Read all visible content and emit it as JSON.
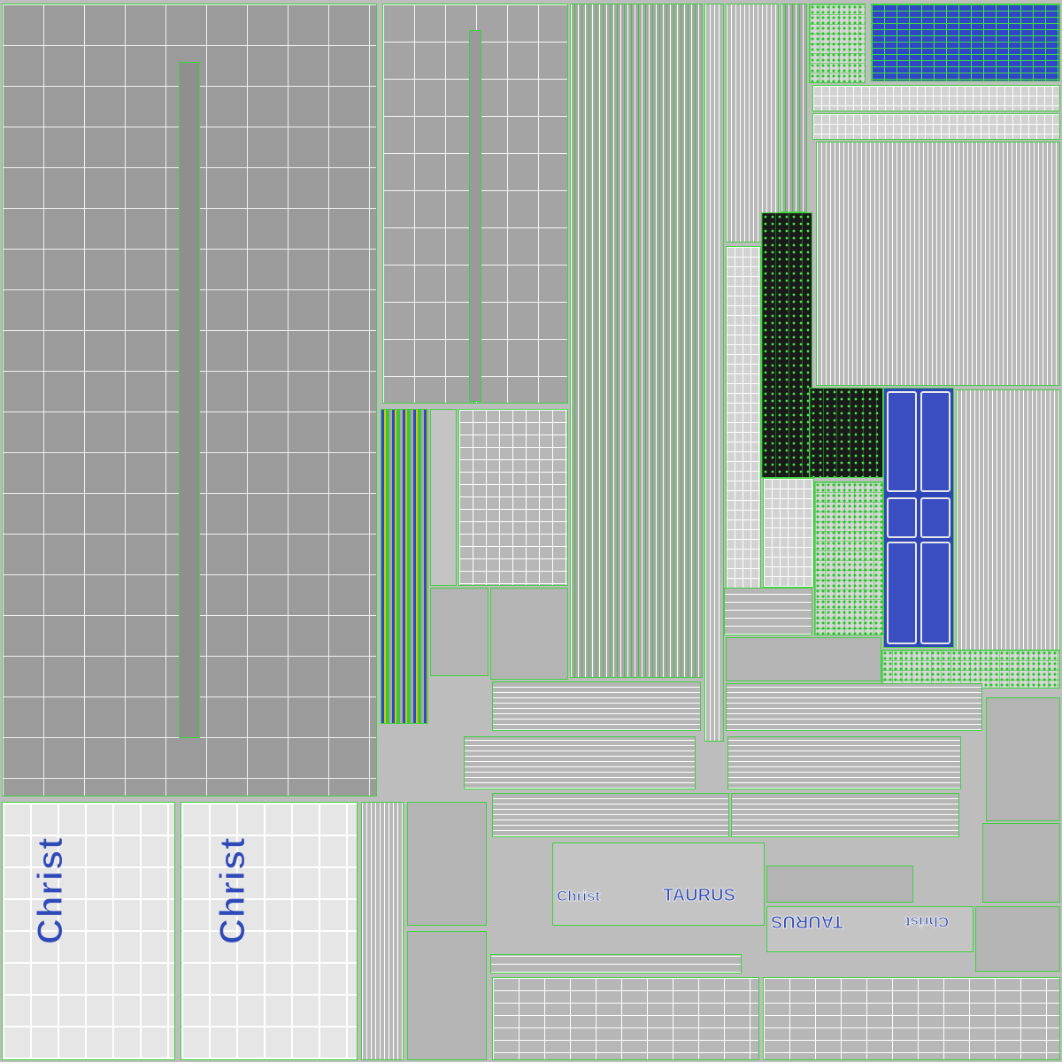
{
  "texture": {
    "panel_logos": [
      "Christ",
      "Christ"
    ],
    "label_christ": "Christ",
    "label_taurus": "TAURUS",
    "label_taurus_flipped": "TAURUS",
    "label_christ_flipped": "Christ"
  },
  "colors": {
    "wire": "#3fd13f",
    "logo_blue": "#2f49b8",
    "blue_fill": "#3a4ec2",
    "concrete": "#9b9b9b"
  }
}
